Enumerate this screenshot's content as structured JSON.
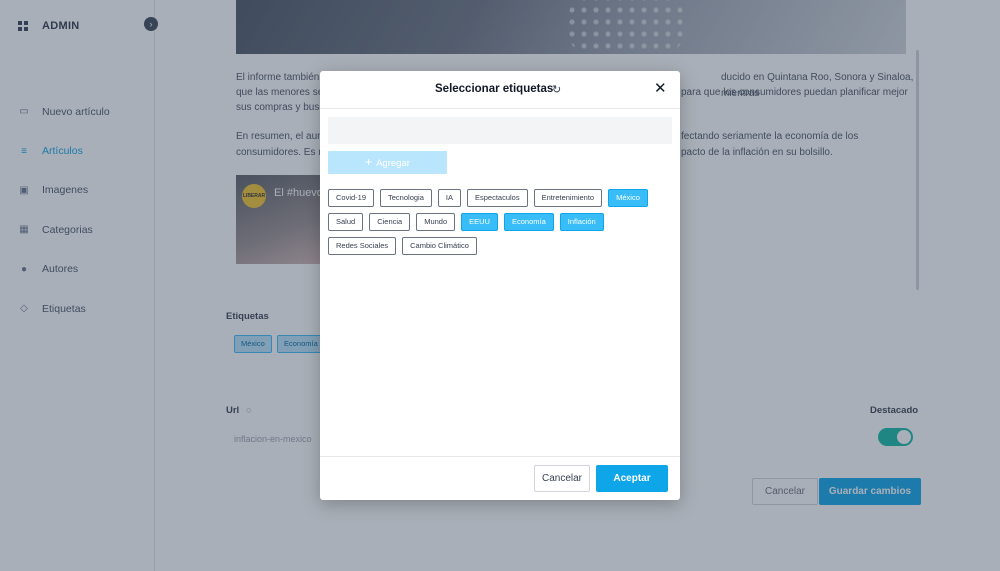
{
  "sidebar": {
    "brand": "ADMIN",
    "collapse_icon": "chevron-right-icon",
    "items": [
      {
        "label": "Nuevo artículo",
        "icon": "document-icon"
      },
      {
        "label": "Artículos",
        "icon": "list-icon",
        "active": true
      },
      {
        "label": "Imagenes",
        "icon": "image-icon"
      },
      {
        "label": "Categorias",
        "icon": "grid-icon"
      },
      {
        "label": "Autores",
        "icon": "user-icon"
      },
      {
        "label": "Etiquetas",
        "icon": "tag-icon"
      }
    ]
  },
  "article": {
    "paragraph1_line1": "El informe también",
    "paragraph1_line1_right": "ducido en Quintana Roo, Sonora y Sinaloa, mientras",
    "paragraph1_line2": "que las menores se",
    "paragraph1_line2_right": "para que los consumidores puedan planificar mejor",
    "paragraph1_line3": "sus compras y busc",
    "paragraph2_line1": "En resumen, el aum",
    "paragraph2_line1_right": "fectando seriamente la economía de los",
    "paragraph2_line2": "consumidores. Es m",
    "paragraph2_line2_right": "pacto de la inflación en su bolsillo.",
    "video_badge": "LIBERAR",
    "video_title": "El #huevo"
  },
  "form": {
    "tags_label": "Etiquetas",
    "selected_tags": [
      "México",
      "Economía"
    ],
    "url_label": "Url",
    "url_value": "inflacion-en-mexico",
    "featured_label": "Destacado",
    "featured": true,
    "cancel_label": "Cancelar",
    "save_label": "Guardar cambios"
  },
  "modal": {
    "title": "Seleccionar etiquetas",
    "search_value": "",
    "add_label": "Agregar",
    "tags": [
      {
        "label": "Covid-19",
        "selected": false
      },
      {
        "label": "Tecnologia",
        "selected": false
      },
      {
        "label": "IA",
        "selected": false
      },
      {
        "label": "Espectaculos",
        "selected": false
      },
      {
        "label": "Entretenimiento",
        "selected": false
      },
      {
        "label": "México",
        "selected": true
      },
      {
        "label": "Salud",
        "selected": false
      },
      {
        "label": "Ciencia",
        "selected": false
      },
      {
        "label": "Mundo",
        "selected": false
      },
      {
        "label": "EEUU",
        "selected": true
      },
      {
        "label": "Economía",
        "selected": true
      },
      {
        "label": "Inflación",
        "selected": true
      },
      {
        "label": "Redes Sociales",
        "selected": false
      },
      {
        "label": "Cambio Climático",
        "selected": false
      }
    ],
    "cancel_label": "Cancelar",
    "accept_label": "Aceptar"
  },
  "colors": {
    "accent": "#0ea5e9",
    "selected_tag": "#38bdf8",
    "toggle_on": "#14b8a6",
    "overlay": "#334155"
  }
}
